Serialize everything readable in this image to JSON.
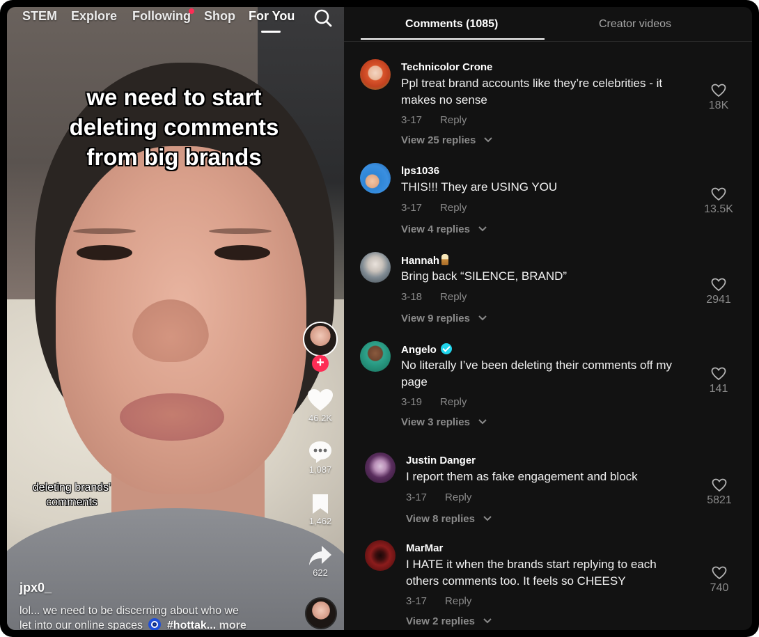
{
  "nav": {
    "items": [
      "STEM",
      "Explore",
      "Following",
      "Shop",
      "For You"
    ],
    "active": "For You",
    "search_icon": "search-icon",
    "notification_color": "#fe2c55"
  },
  "video": {
    "caption_lines": [
      "we need to start",
      "deleting comments",
      "from big brands"
    ],
    "sticker_lines": [
      "deleting brands'",
      "comments"
    ],
    "author": "jpx0_",
    "description_line1": "lol... we need to be discerning about who we",
    "description_line2_pre": "let into our online spaces",
    "description_hashtag": "#hottak...",
    "description_more": "more",
    "actions": {
      "like_count": "46.2K",
      "comment_count": "1,087",
      "save_count": "1,462",
      "share_count": "622"
    },
    "follow_symbol": "+"
  },
  "tabs": {
    "comments": "Comments (1085)",
    "creator_videos": "Creator videos"
  },
  "comments": [
    {
      "name": "Technicolor Crone",
      "text": "Ppl treat brand accounts like they’re celebrities - it makes no sense",
      "date": "3-17",
      "reply": "Reply",
      "view_replies": "View 25 replies",
      "likes": "18K"
    },
    {
      "name": "lps1036",
      "text": "THIS!!! They are USING YOU",
      "date": "3-17",
      "reply": "Reply",
      "view_replies": "View 4 replies",
      "likes": "13.5K"
    },
    {
      "name": "Hannah",
      "text": "Bring back “SILENCE, BRAND”",
      "date": "3-18",
      "reply": "Reply",
      "view_replies": "View 9 replies",
      "likes": "2941"
    },
    {
      "name": "Angelo",
      "text": "No literally I’ve been deleting their comments off my page",
      "date": "3-19",
      "reply": "Reply",
      "view_replies": "View 3 replies",
      "likes": "141"
    },
    {
      "name": "Justin Danger",
      "text": "I report them as fake engagement and block",
      "date": "3-17",
      "reply": "Reply",
      "view_replies": "View 8 replies",
      "likes": "5821"
    },
    {
      "name": "MarMar",
      "text": "I HATE it when the brands start replying to each others comments too. It feels so CHEESY",
      "date": "3-17",
      "reply": "Reply",
      "view_replies": "View 2 replies",
      "likes": "740"
    }
  ],
  "colors": {
    "panel_bg": "#121212",
    "accent": "#fe2c55",
    "verified": "#20d5ec",
    "muted_text": "#8a8a8a"
  }
}
